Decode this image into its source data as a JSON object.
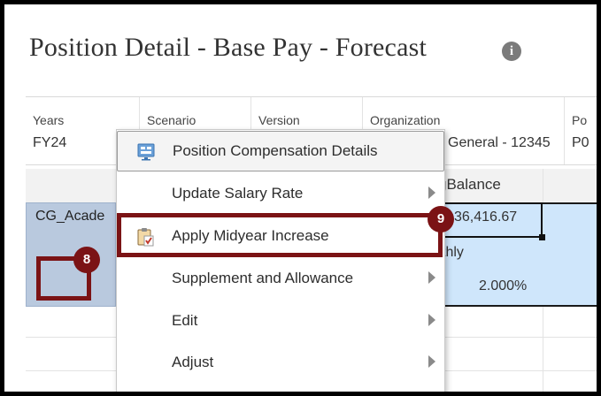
{
  "page": {
    "title": "Position Detail - Base Pay - Forecast"
  },
  "pov": [
    {
      "label": "Years",
      "value": "FY24"
    },
    {
      "label": "Scenario",
      "value": ""
    },
    {
      "label": "Version",
      "value": ""
    },
    {
      "label": "Organization",
      "value": "General - 12345"
    },
    {
      "label": "Po",
      "value": "P0"
    }
  ],
  "grid": {
    "column_header": "gBalance",
    "row_header": "CG_Acade",
    "cells": {
      "balance": "36,416.67",
      "frequency": "thly",
      "rate": "2.000%"
    }
  },
  "context_menu": {
    "items": [
      {
        "label": "Position Compensation Details",
        "icon": "monitor-icon",
        "submenu": false
      },
      {
        "label": "Update Salary Rate",
        "icon": "",
        "submenu": true
      },
      {
        "label": "Apply Midyear Increase",
        "icon": "clipboard-icon",
        "submenu": false
      },
      {
        "label": "Supplement and Allowance",
        "icon": "",
        "submenu": true
      },
      {
        "label": "Edit",
        "icon": "",
        "submenu": true
      },
      {
        "label": "Adjust",
        "icon": "",
        "submenu": true
      }
    ]
  },
  "callouts": {
    "step8": "8",
    "step9": "9"
  },
  "colors": {
    "callout": "#7b1315",
    "selection": "#cfe6fb",
    "row_header": "#b9c9de"
  }
}
